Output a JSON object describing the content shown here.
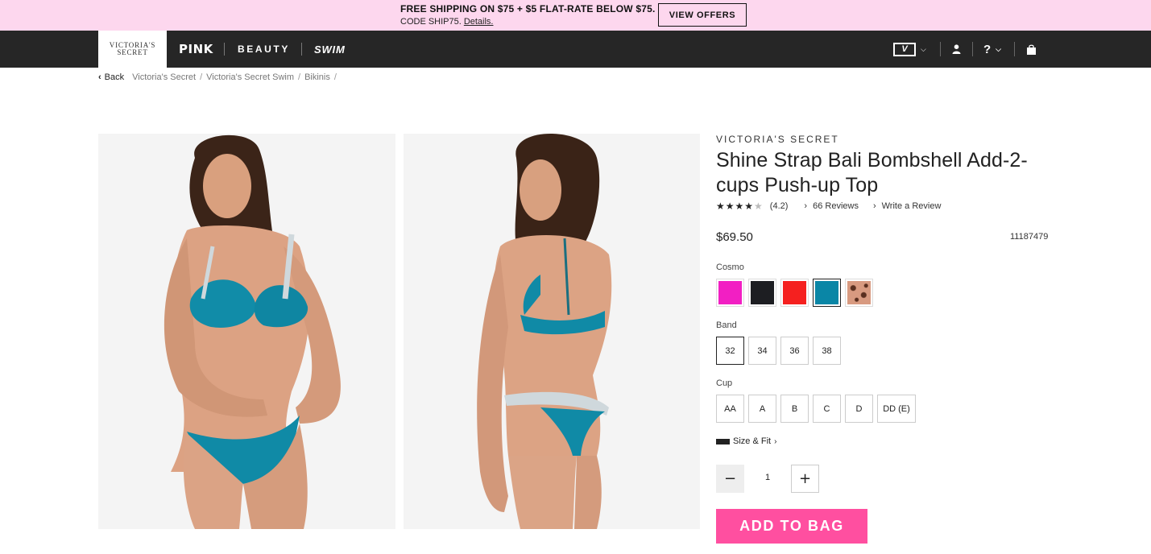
{
  "promo": {
    "line1": "FREE SHIPPING ON $75 + $5 FLAT-RATE BELOW $75.",
    "line2": "CODE SHIP75.",
    "details": "Details.",
    "button": "VIEW OFFERS",
    "bg_color": "#fdd7ee"
  },
  "nav": {
    "logo_line1": "VICTORIA'S",
    "logo_line2": "SECRET",
    "links": [
      "PINK",
      "BEAUTY",
      "SWIM"
    ],
    "vs_badge": "V",
    "help": "?",
    "icons": [
      "vs-account-dropdown-icon",
      "user-icon",
      "help-icon",
      "shopping-bag-icon"
    ]
  },
  "breadcrumb": {
    "back": "Back",
    "items": [
      "Victoria's Secret",
      "Victoria's Secret Swim",
      "Bikinis"
    ],
    "separator": "/"
  },
  "product": {
    "brand": "VICTORIA'S SECRET",
    "title": "Shine Strap Bali Bombshell Add-2-cups Push-up Top",
    "rating": 4.2,
    "rating_text": "(4.2)",
    "reviews_link": "66 Reviews",
    "write_review": "Write a Review",
    "price": "$69.50",
    "sku": "11187479",
    "color_label": "Cosmo",
    "colors": [
      {
        "name": "magenta",
        "hex": "#f21fc3",
        "selected": false
      },
      {
        "name": "black",
        "hex": "#1d1e22",
        "selected": false
      },
      {
        "name": "red",
        "hex": "#f5201f",
        "selected": false
      },
      {
        "name": "cosmo",
        "hex": "#0a86a6",
        "selected": true
      },
      {
        "name": "leopard",
        "hex": "#c98b73",
        "selected": false
      }
    ],
    "band_label": "Band",
    "bands": [
      "32",
      "34",
      "36",
      "38"
    ],
    "selected_band": "32",
    "cup_label": "Cup",
    "cups": [
      "AA",
      "A",
      "B",
      "C",
      "D",
      "DD (E)"
    ],
    "size_fit": "Size & Fit",
    "quantity": "1",
    "add_to_bag": "ADD TO BAG",
    "accent_color": "#ff4fa0"
  }
}
